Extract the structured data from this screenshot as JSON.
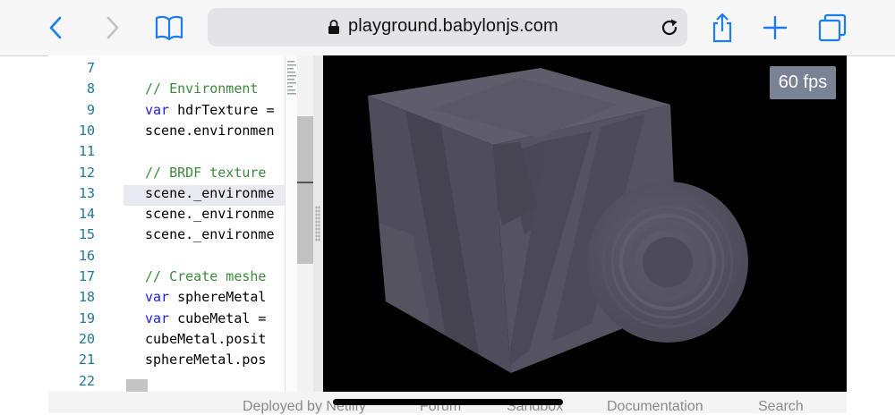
{
  "browser": {
    "url": "playground.babylonjs.com",
    "icons": [
      "back-icon",
      "forward-icon",
      "bookmarks-icon",
      "lock-icon",
      "reload-icon",
      "share-icon",
      "new-tab-icon",
      "tabs-icon"
    ],
    "accent_color": "#1e7cf2"
  },
  "editor": {
    "lines": [
      {
        "num": "7",
        "code": "",
        "kind": "plain"
      },
      {
        "num": "8",
        "code": "// Environment",
        "kind": "comment"
      },
      {
        "num": "9",
        "kw": "var",
        "code": " hdrTexture =",
        "kind": "kw"
      },
      {
        "num": "10",
        "code": "scene.environmen",
        "kind": "plain"
      },
      {
        "num": "11",
        "code": "",
        "kind": "plain"
      },
      {
        "num": "12",
        "code": "// BRDF texture",
        "kind": "comment"
      },
      {
        "num": "13",
        "code": "scene._environme",
        "kind": "plain"
      },
      {
        "num": "14",
        "code": "scene._environme",
        "kind": "plain"
      },
      {
        "num": "15",
        "code": "scene._environme",
        "kind": "plain"
      },
      {
        "num": "16",
        "code": "",
        "kind": "plain"
      },
      {
        "num": "17",
        "code": "// Create meshe",
        "kind": "comment"
      },
      {
        "num": "18",
        "kw": "var",
        "code": " sphereMetal",
        "kind": "kw"
      },
      {
        "num": "19",
        "kw": "var",
        "code": " cubeMetal =",
        "kind": "kw"
      },
      {
        "num": "20",
        "code": "cubeMetal.posit",
        "kind": "plain"
      },
      {
        "num": "21",
        "code": "sphereMetal.pos",
        "kind": "plain"
      },
      {
        "num": "22",
        "code": "",
        "kind": "plain"
      }
    ]
  },
  "render": {
    "fps_label": "60 fps"
  },
  "footer": {
    "links": [
      "Deployed by Netlify",
      "Forum",
      "Sandbox",
      "Documentation",
      "Search"
    ]
  }
}
